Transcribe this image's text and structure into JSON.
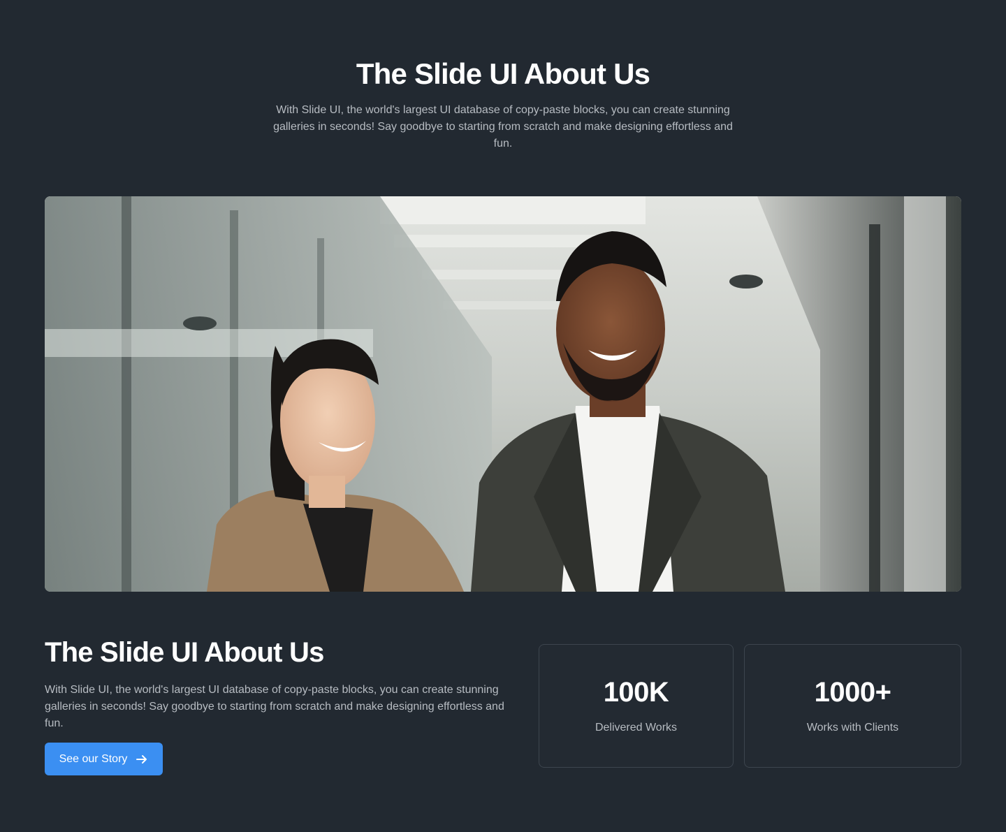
{
  "hero": {
    "title": "The Slide UI About Us",
    "description": "With Slide UI, the world's largest UI database of copy-paste blocks, you can create stunning galleries in seconds! Say goodbye to starting from scratch and make designing effortless and fun."
  },
  "photo": {
    "subject": "office-team-photo"
  },
  "about": {
    "title": "The Slide UI About Us",
    "description": "With Slide UI, the world's largest UI database of copy-paste blocks, you can create stunning galleries in seconds! Say goodbye to starting from scratch and make designing effortless and fun.",
    "button_label": "See our Story",
    "button_icon": "arrow-right-icon"
  },
  "stats": [
    {
      "value": "100K",
      "label": "Delivered Works"
    },
    {
      "value": "1000+",
      "label": "Works with Clients"
    }
  ],
  "colors": {
    "background": "#222931",
    "accent": "#3b8ff2",
    "muted_text": "#b7bcc2",
    "card_border": "#3d454e"
  }
}
